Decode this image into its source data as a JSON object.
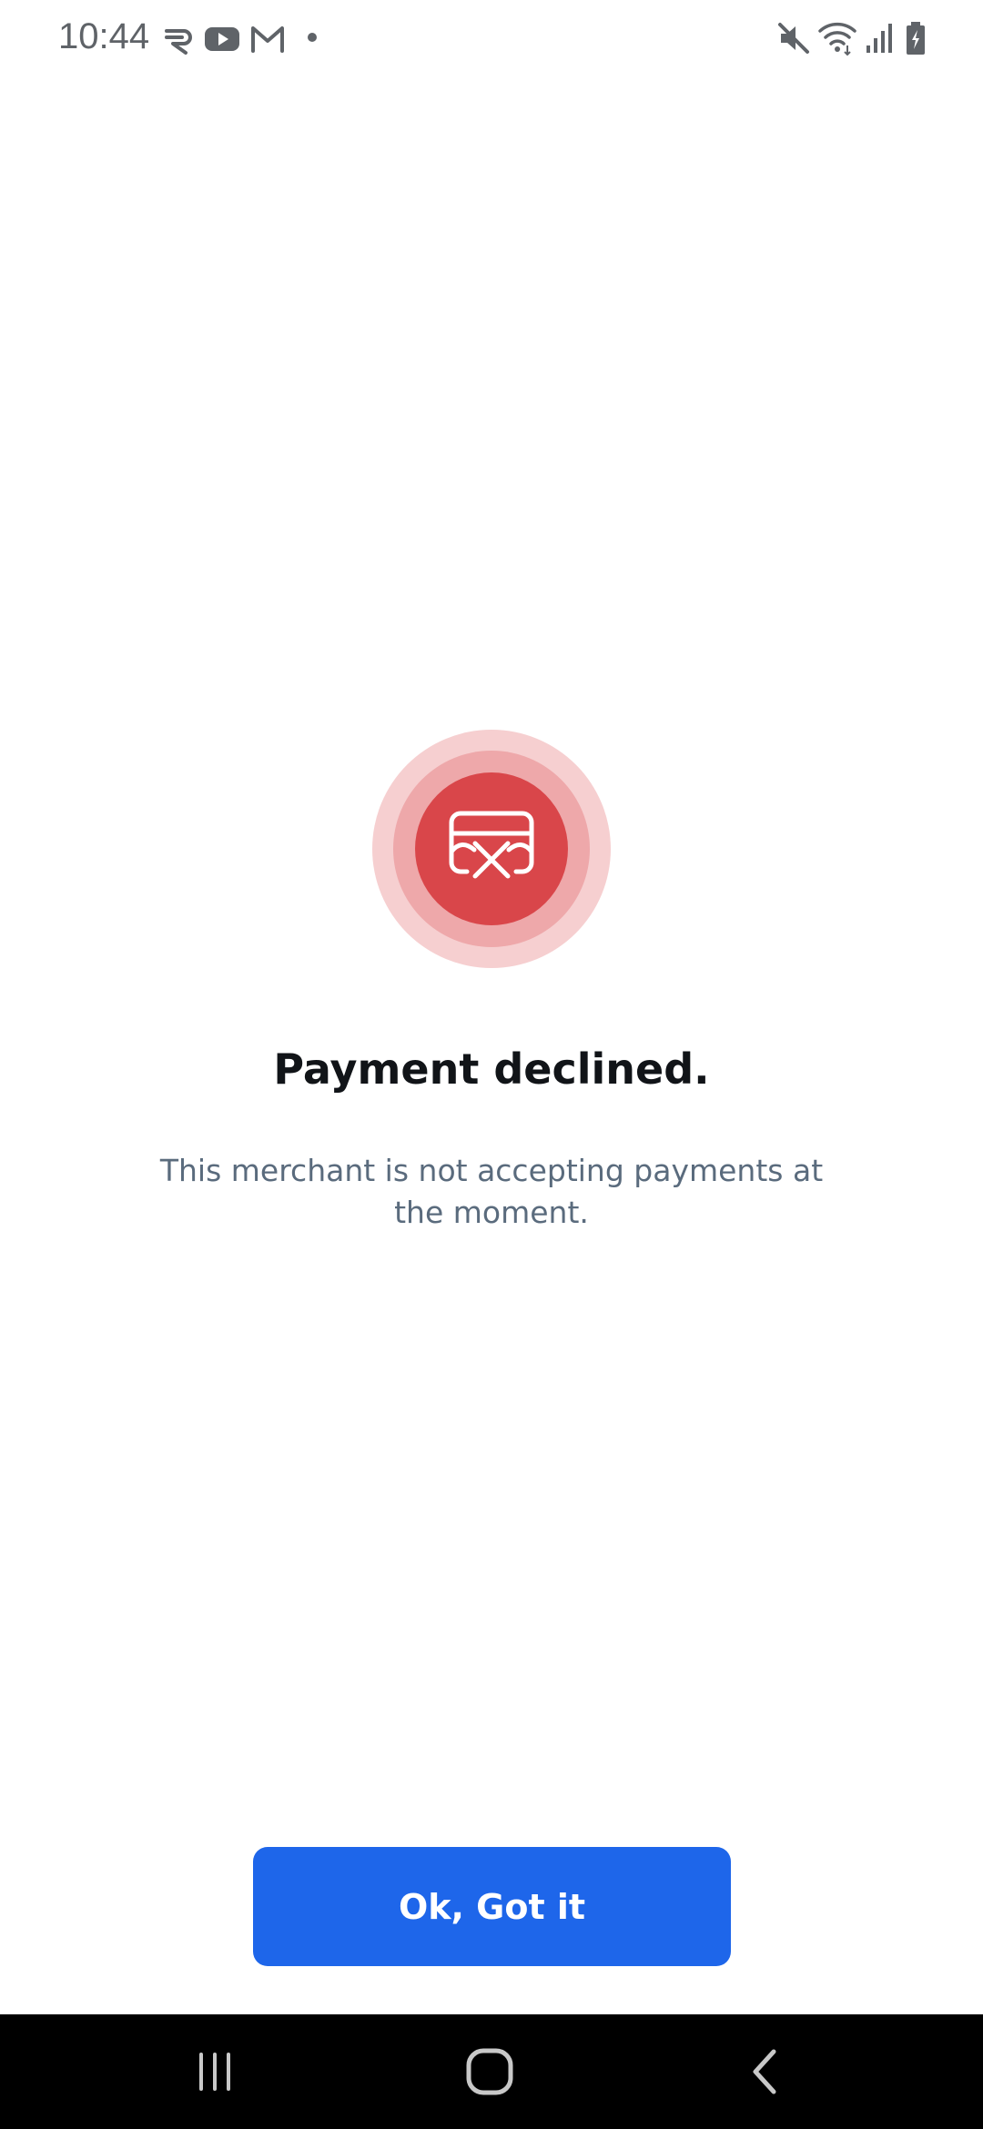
{
  "status_bar": {
    "time": "10:44",
    "notification_icons": [
      "r-app-icon",
      "youtube-icon",
      "gmail-icon",
      "dot-icon"
    ],
    "system_icons": [
      "mute-icon",
      "wifi-icon",
      "signal-icon",
      "battery-icon"
    ]
  },
  "result": {
    "icon": "card-declined-icon",
    "title": "Payment declined.",
    "message": "This merchant is not accepting payments at the moment."
  },
  "actions": {
    "confirm_label": "Ok, Got it"
  },
  "colors": {
    "accent": "#1e66ea",
    "error": "#d9464a",
    "error_ring_inner": "#eea8aa",
    "error_ring_outer": "#f6cfd0",
    "title_text": "#111418",
    "body_text": "#5a6b7d"
  },
  "nav_bar": {
    "buttons": [
      "recent-apps-icon",
      "home-icon",
      "back-icon"
    ]
  }
}
